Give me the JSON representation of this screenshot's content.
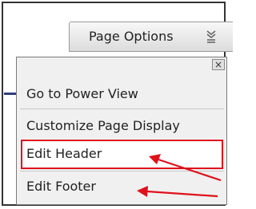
{
  "toolbar": {
    "page_options_label": "Page Options"
  },
  "menu": {
    "close_glyph": "×",
    "items": [
      {
        "label": "Go to Power View"
      },
      {
        "label": "Customize Page Display"
      },
      {
        "label": "Edit Header"
      },
      {
        "label": "Edit Footer"
      }
    ]
  },
  "colors": {
    "annotation_red": "#e0101a",
    "accent_blue": "#2d3e7e"
  },
  "icons": {
    "options": "chevron-list-icon",
    "close": "close-icon"
  }
}
